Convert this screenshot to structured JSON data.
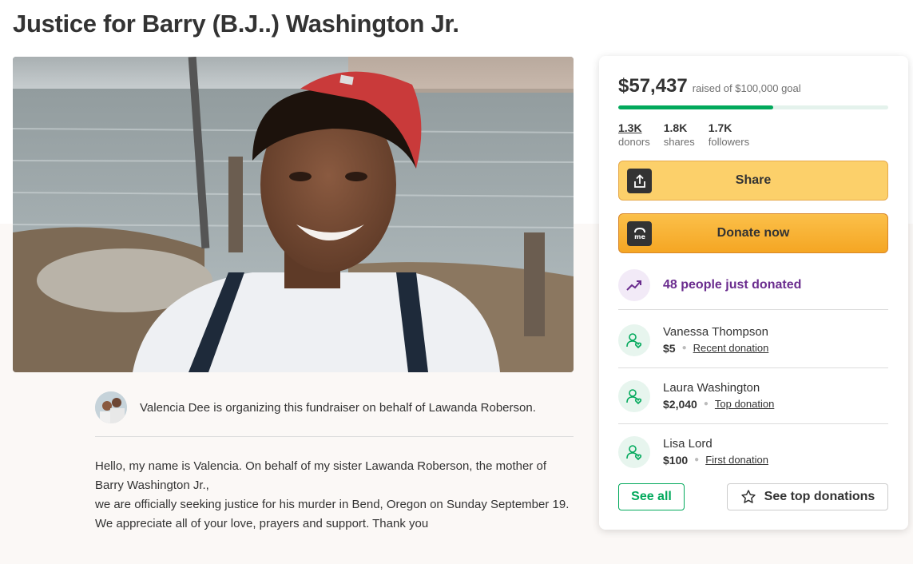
{
  "page": {
    "title": "Justice for Barry (B.J..) Washington Jr."
  },
  "organizer": {
    "text": "Valencia Dee is organizing this fundraiser on behalf of Lawanda Roberson."
  },
  "story": {
    "paragraphs": [
      "Hello, my name is Valencia. On behalf of my sister Lawanda Roberson, the mother of Barry Washington Jr.,",
      "we are officially seeking justice for his murder in Bend, Oregon on Sunday September 19.",
      "We appreciate all of your love, prayers and support. Thank you"
    ]
  },
  "donation_card": {
    "raised_amount": "$57,437",
    "raised_goal_text": "raised of $100,000 goal",
    "progress_fraction": 0.574,
    "stats": [
      {
        "value": "1.3K",
        "label": "donors"
      },
      {
        "value": "1.8K",
        "label": "shares"
      },
      {
        "value": "1.7K",
        "label": "followers"
      }
    ],
    "share_label": "Share",
    "donate_label": "Donate now",
    "trending_text": "48 people just donated",
    "donations": [
      {
        "name": "Vanessa Thompson",
        "amount": "$5",
        "type": "Recent donation"
      },
      {
        "name": "Laura Washington",
        "amount": "$2,040",
        "type": "Top donation"
      },
      {
        "name": "Lisa Lord",
        "amount": "$100",
        "type": "First donation"
      }
    ],
    "see_all_label": "See all",
    "see_top_label": "See top donations"
  },
  "colors": {
    "accent_green": "#02a95c",
    "share_yellow": "#fcd06a",
    "donate_orange": "#f5a623",
    "trend_purple": "#6a2c8e"
  }
}
